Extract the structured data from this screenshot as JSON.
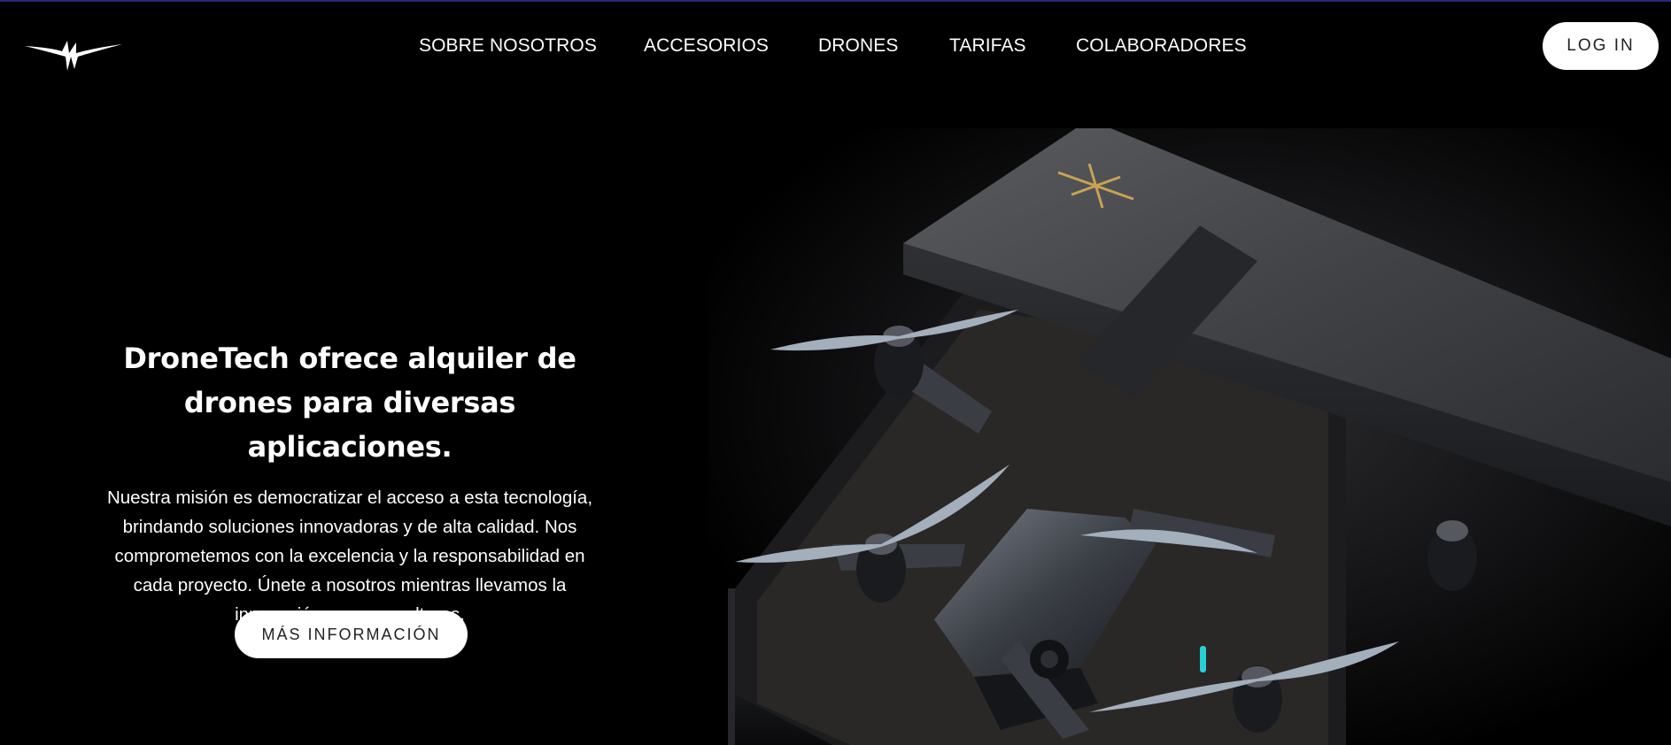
{
  "header": {
    "logo_icon": "winged-drone-logo-icon",
    "nav": [
      {
        "label": "SOBRE NOSOTROS"
      },
      {
        "label": "ACCESORIOS"
      },
      {
        "label": "DRONES"
      },
      {
        "label": "TARIFAS"
      },
      {
        "label": "COLABORADORES"
      }
    ],
    "login_label": "LOG IN"
  },
  "hero": {
    "title_line1": "DroneTech ofrece alquiler de",
    "title_line2": "drones para diversas aplicaciones.",
    "desc_lines": [
      "Nuestra misión es democratizar el acceso a esta tecnología,",
      "brindando soluciones innovadoras y de alta calidad. Nos",
      "comprometemos con la excelencia y la responsabilidad en",
      "cada proyecto. Únete a nosotros mientras llevamos la",
      "innovación a nuevas alturas."
    ],
    "cta_label": "MÁS INFORMACIÓN",
    "image": "drone-in-gift-box-image"
  },
  "colors": {
    "background": "#000000",
    "accent_line": "#2a2670",
    "button_bg": "#ffffff",
    "button_text": "#222222",
    "logo_gold": "#c9a352"
  }
}
